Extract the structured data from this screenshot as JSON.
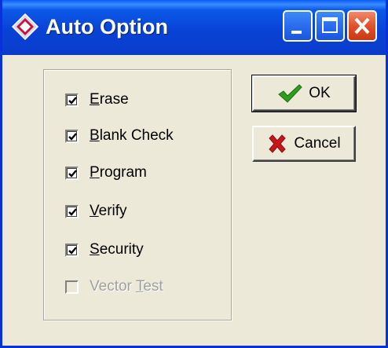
{
  "window": {
    "title": "Auto Option"
  },
  "options": [
    {
      "mnemonic": "E",
      "rest": "rase",
      "checked": true,
      "enabled": true
    },
    {
      "mnemonic": "B",
      "rest": "lank Check",
      "checked": true,
      "enabled": true
    },
    {
      "mnemonic": "P",
      "rest": "rogram",
      "checked": true,
      "enabled": true
    },
    {
      "mnemonic": "V",
      "rest": "erify",
      "checked": true,
      "enabled": true
    },
    {
      "mnemonic": "S",
      "rest": "ecurity",
      "checked": true,
      "enabled": true
    },
    {
      "pre": "Vector ",
      "mnemonic": "T",
      "rest": "est",
      "checked": false,
      "enabled": false
    }
  ],
  "buttons": {
    "ok": {
      "label": "OK",
      "icon": "check-icon"
    },
    "cancel": {
      "label": "Cancel",
      "icon": "x-icon"
    }
  },
  "colors": {
    "check_green": "#2e9e1f",
    "cancel_red": "#c4161c"
  }
}
